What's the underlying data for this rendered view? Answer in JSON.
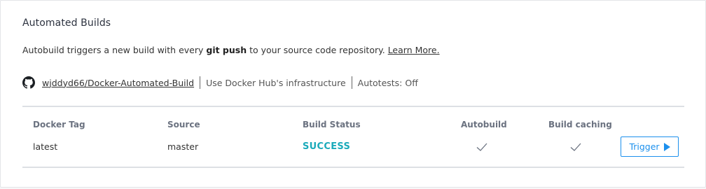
{
  "section": {
    "title": "Automated Builds",
    "description_prefix": "Autobuild triggers a new build with every ",
    "description_bold": "git push",
    "description_suffix": " to your source code repository. ",
    "learn_more": "Learn More."
  },
  "repo": {
    "icon": "github-icon",
    "name": "wjddyd66/Docker-Automated-Build",
    "infrastructure": "Use Docker Hub's infrastructure",
    "autotests": "Autotests: Off"
  },
  "table": {
    "headers": {
      "docker_tag": "Docker Tag",
      "source": "Source",
      "build_status": "Build Status",
      "autobuild": "Autobuild",
      "build_caching": "Build caching"
    },
    "rows": [
      {
        "docker_tag": "latest",
        "source": "master",
        "build_status": "SUCCESS",
        "autobuild": true,
        "build_caching": true,
        "trigger_label": "Trigger"
      }
    ]
  },
  "colors": {
    "status_success": "#1aaaba",
    "accent": "#1c90ed"
  }
}
